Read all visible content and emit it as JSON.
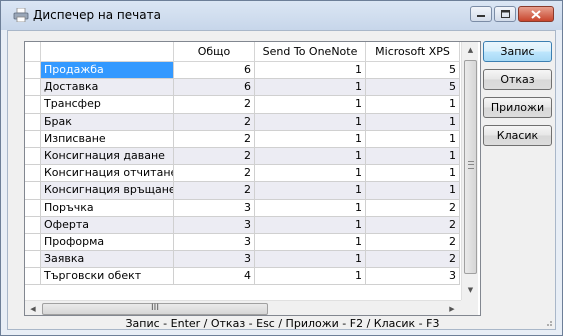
{
  "window": {
    "title": "Диспечер на печата",
    "controls": {
      "minimize": "minimize",
      "maximize": "maximize",
      "close": "close"
    }
  },
  "grid": {
    "columns": [
      "",
      "Общо",
      "Send To OneNote",
      "Microsoft XPS"
    ],
    "rows": [
      {
        "name": "Продажба",
        "total": "6",
        "onenote": "1",
        "xps": "5"
      },
      {
        "name": "Доставка",
        "total": "6",
        "onenote": "1",
        "xps": "5"
      },
      {
        "name": "Трансфер",
        "total": "2",
        "onenote": "1",
        "xps": "1"
      },
      {
        "name": "Брак",
        "total": "2",
        "onenote": "1",
        "xps": "1"
      },
      {
        "name": "Изписване",
        "total": "2",
        "onenote": "1",
        "xps": "1"
      },
      {
        "name": "Консигнация даване",
        "total": "2",
        "onenote": "1",
        "xps": "1"
      },
      {
        "name": "Консигнация отчитане",
        "total": "2",
        "onenote": "1",
        "xps": "1"
      },
      {
        "name": "Консигнация връщане",
        "total": "2",
        "onenote": "1",
        "xps": "1"
      },
      {
        "name": "Поръчка",
        "total": "3",
        "onenote": "1",
        "xps": "2"
      },
      {
        "name": "Оферта",
        "total": "3",
        "onenote": "1",
        "xps": "2"
      },
      {
        "name": "Проформа",
        "total": "3",
        "onenote": "1",
        "xps": "2"
      },
      {
        "name": "Заявка",
        "total": "3",
        "onenote": "1",
        "xps": "2"
      },
      {
        "name": "Търговски обект",
        "total": "4",
        "onenote": "1",
        "xps": "3"
      }
    ],
    "selected_row": 0,
    "hscroll_grip": "III"
  },
  "buttons": {
    "save": "Запис",
    "cancel": "Отказ",
    "apply": "Приложи",
    "classic": "Класик"
  },
  "status": {
    "shortcuts": "Запис - Enter / Отказ - Esc / Приложи - F2 / Класик - F3"
  },
  "colors": {
    "selection": "#3399ff",
    "alt_row": "#ececf3",
    "titlebar": "#c7d6ea",
    "close_button": "#c8452c"
  }
}
